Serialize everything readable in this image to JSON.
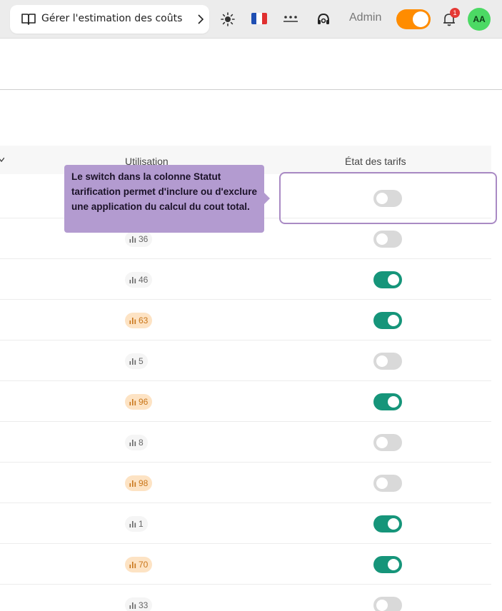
{
  "topbar": {
    "guide_label": "Gérer l'estimation des coûts",
    "admin_label": "Admin",
    "notification_count": "1",
    "avatar_initials": "AA",
    "admin_toggle_on": true,
    "colors": {
      "admin_toggle": "#ff8c00",
      "avatar": "#4cd964",
      "badge": "#e53935"
    }
  },
  "table": {
    "headers": {
      "utilisation": "Utilisation",
      "etat": "État des tarifs"
    },
    "rows": [
      {
        "usage": "",
        "level": "",
        "pricing_on": false
      },
      {
        "usage": "36",
        "level": "low",
        "pricing_on": false
      },
      {
        "usage": "46",
        "level": "low",
        "pricing_on": true
      },
      {
        "usage": "63",
        "level": "high",
        "pricing_on": true
      },
      {
        "usage": "5",
        "level": "low",
        "pricing_on": false
      },
      {
        "usage": "96",
        "level": "high",
        "pricing_on": true
      },
      {
        "usage": "8",
        "level": "low",
        "pricing_on": false
      },
      {
        "usage": "98",
        "level": "high",
        "pricing_on": false
      },
      {
        "usage": "1",
        "level": "low",
        "pricing_on": true
      },
      {
        "usage": "70",
        "level": "high",
        "pricing_on": true
      },
      {
        "usage": "33",
        "level": "low",
        "pricing_on": false
      }
    ],
    "colors": {
      "switch_on": "#16957a",
      "switch_off": "#d9d9d9",
      "chip_high_bg": "#fde3c4",
      "chip_high_text": "#c9761a"
    }
  },
  "tooltip": {
    "text": "Le switch dans la colonne Statut tarification permet d'inclure ou d'exclure une application du calcul du cout total."
  }
}
